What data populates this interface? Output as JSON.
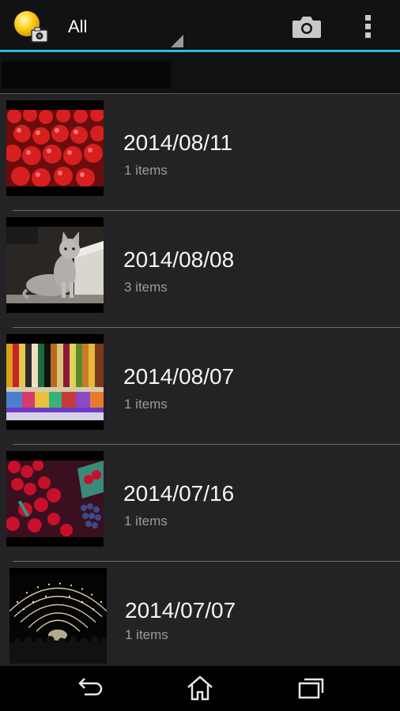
{
  "actionbar": {
    "title": "All",
    "app_icon": "gallery-app-icon",
    "camera_icon": "camera-icon",
    "overflow_icon": "overflow-menu-icon"
  },
  "items": [
    {
      "date": "2014/08/11",
      "count": "1 items",
      "thumbnail": "tomatoes-photo"
    },
    {
      "date": "2014/08/08",
      "count": "3 items",
      "thumbnail": "cat-photo"
    },
    {
      "date": "2014/08/07",
      "count": "1 items",
      "thumbnail": "fabric-shop-photo"
    },
    {
      "date": "2014/07/16",
      "count": "1 items",
      "thumbnail": "berries-photo"
    },
    {
      "date": "2014/07/07",
      "count": "1 items",
      "thumbnail": "light-tunnel-photo"
    }
  ],
  "navbar": {
    "back_icon": "back-icon",
    "home_icon": "home-icon",
    "recents_icon": "recent-apps-icon"
  },
  "colors": {
    "accent": "#33b5e5",
    "background": "#232325",
    "bar": "#111214"
  }
}
